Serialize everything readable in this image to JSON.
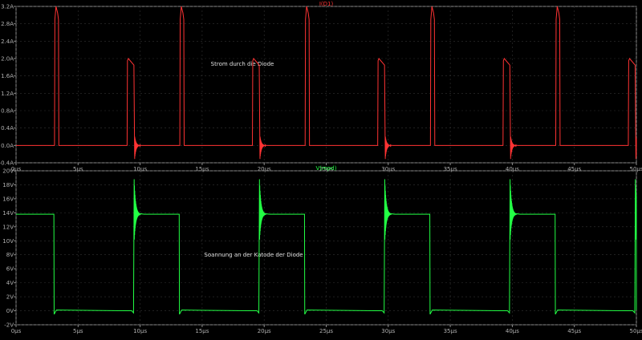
{
  "chart_data": [
    {
      "type": "line",
      "title": "I(D1)",
      "annotation": "Strom durch die Diode",
      "color": "#ff3333",
      "xlim": [
        0,
        50
      ],
      "ylim": [
        -0.4,
        3.2
      ],
      "x_ticks": [
        "0µs",
        "5µs",
        "10µs",
        "15µs",
        "20µs",
        "25µs",
        "30µs",
        "35µs",
        "40µs",
        "45µs",
        "50µs"
      ],
      "y_ticks": [
        "3.2A",
        "2.8A",
        "2.4A",
        "2.0A",
        "1.6A",
        "1.2A",
        "0.8A",
        "0.4A",
        "0.0A",
        "-0.4A"
      ],
      "series": [
        {
          "x": [
            0,
            3.0,
            3.05,
            3.15,
            3.3,
            3.4,
            3.45,
            13.3,
            13.35,
            13.45,
            13.55,
            13.65
          ],
          "y": [
            0.0,
            0.0,
            2.9,
            3.1,
            3.05,
            2.95,
            0.0,
            0.0,
            2.95,
            3.15,
            3.05,
            2.95
          ]
        }
      ],
      "pulse_period_us": 10.1,
      "large_pulse_peak_A": 3.2,
      "large_pulse_plateau_A": 2.9,
      "small_pulse_peak_A": 2.0,
      "small_pulse_end_A": 1.85,
      "ringing_min_A": -0.35,
      "ringing_max_A": 0.25
    },
    {
      "type": "line",
      "title": "V(mpd)",
      "annotation": "Soannung an der Katode der Diode",
      "color": "#22ff44",
      "xlim": [
        0,
        50
      ],
      "ylim": [
        -2,
        20
      ],
      "x_ticks": [
        "0µs",
        "5µs",
        "10µs",
        "15µs",
        "20µs",
        "25µs",
        "30µs",
        "35µs",
        "40µs",
        "45µs",
        "50µs"
      ],
      "y_ticks": [
        "20V",
        "18V",
        "16V",
        "14V",
        "12V",
        "10V",
        "8V",
        "6V",
        "4V",
        "2V",
        "0V",
        "-2V"
      ],
      "high_level_V": 13.8,
      "low_level_V": 0.0,
      "spike_max_V": 18.8,
      "spike_min_V": 9.8
    }
  ]
}
